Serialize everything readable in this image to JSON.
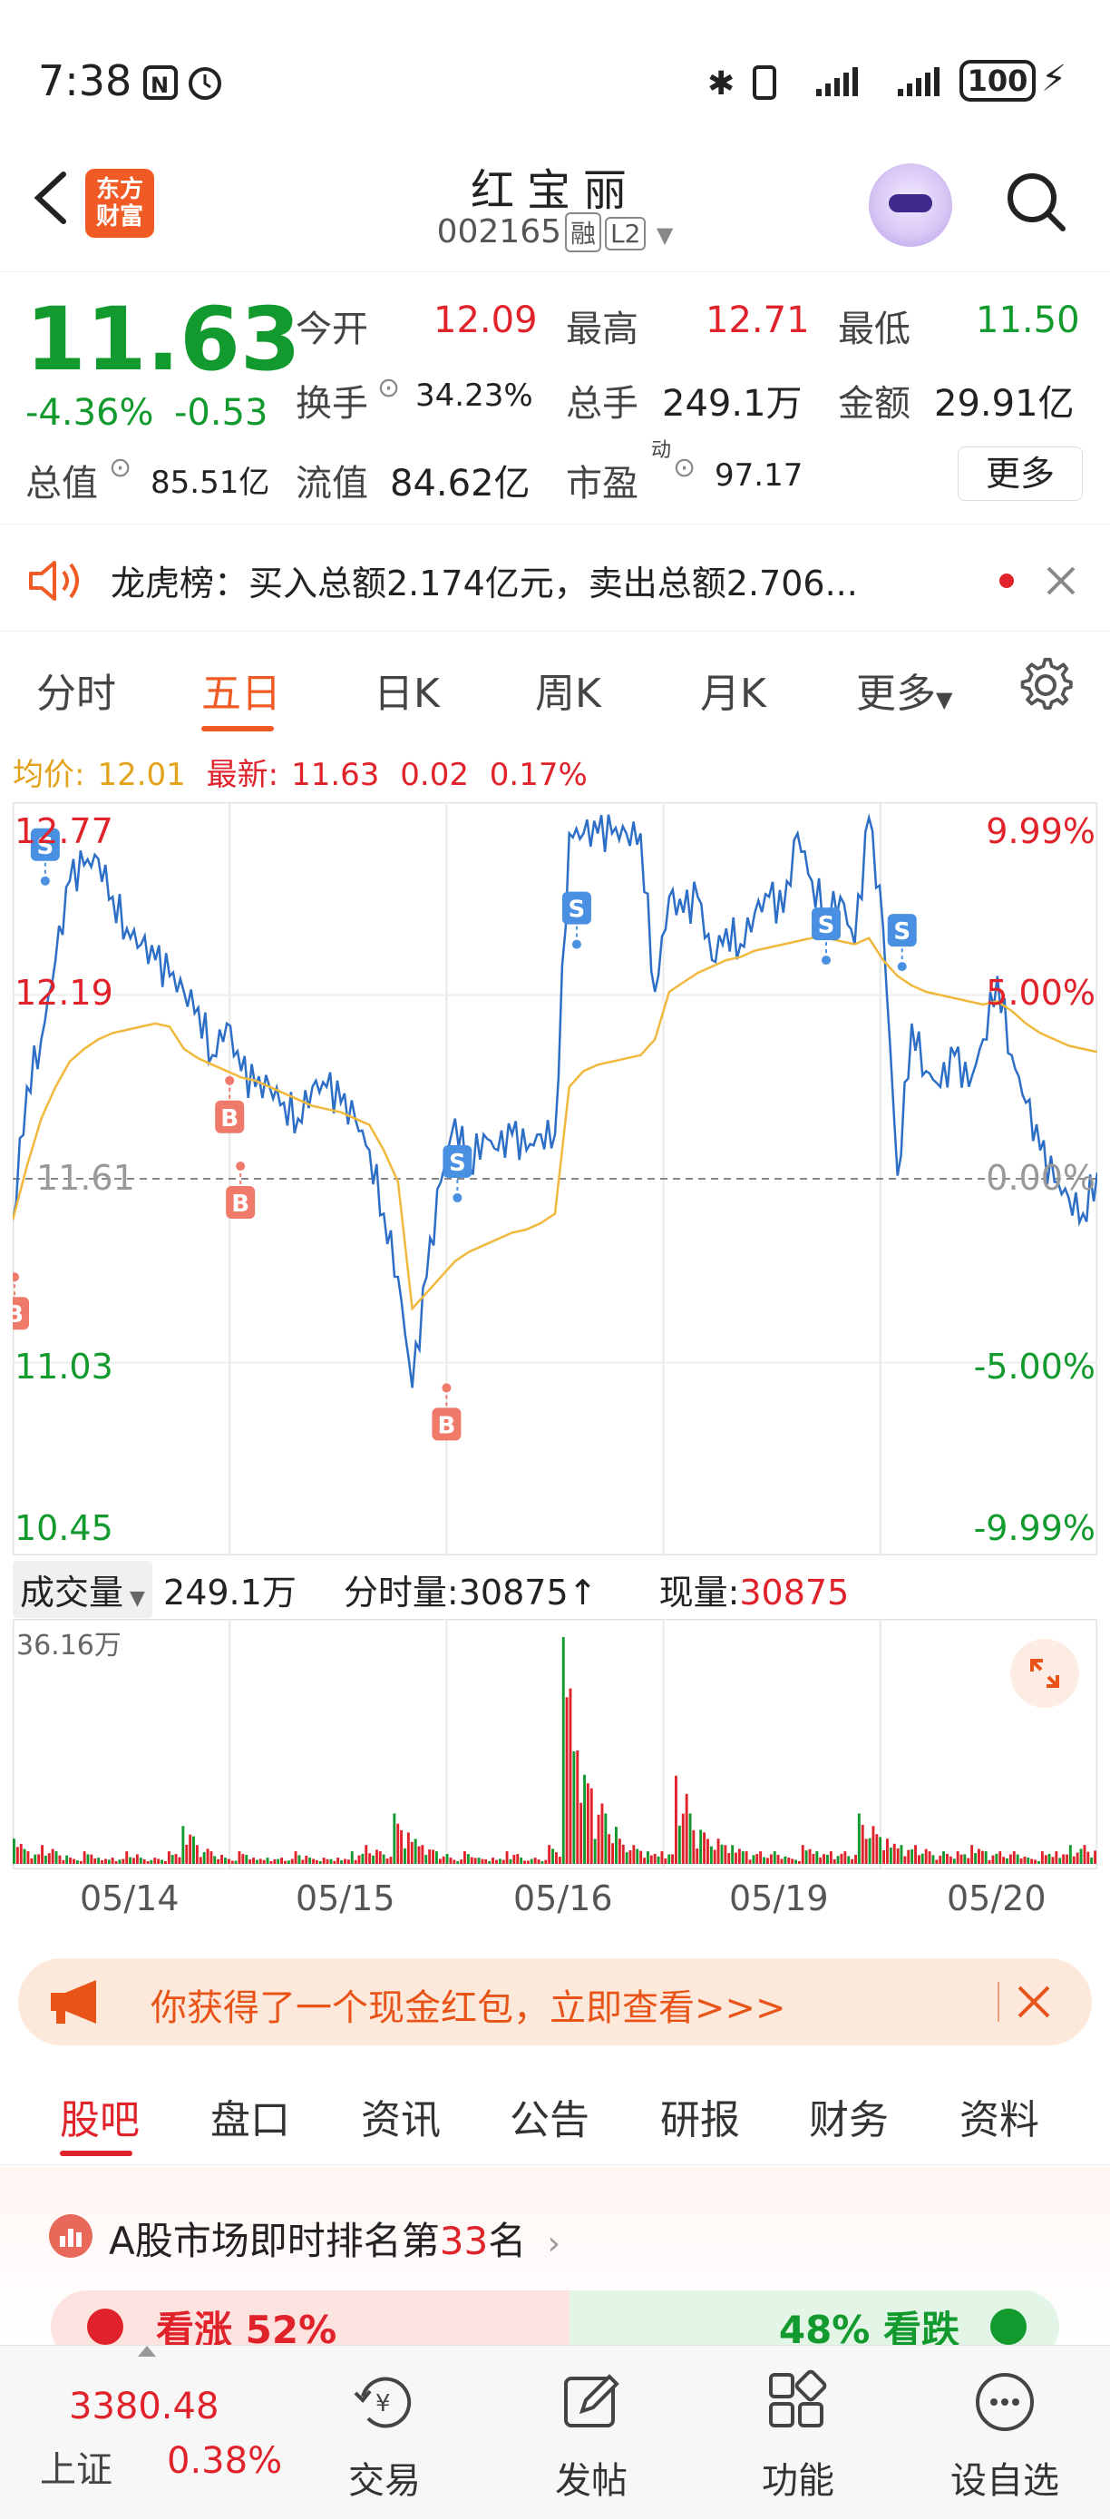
{
  "status_bar": {
    "time": "7:38",
    "battery": "100"
  },
  "header": {
    "title": "红宝丽",
    "code": "002165",
    "tags": [
      "融",
      "L2"
    ],
    "logo_text_1": "东方",
    "logo_text_2": "财富"
  },
  "quote": {
    "price": "11.63",
    "change_pct": "-4.36%",
    "change": "-0.53",
    "open_label": "今开",
    "open": "12.09",
    "high_label": "最高",
    "high": "12.71",
    "low_label": "最低",
    "low": "11.50",
    "turnover_label": "换手",
    "turnover": "34.23%",
    "volume_label": "总手",
    "volume": "249.1万",
    "amount_label": "金额",
    "amount": "29.91亿",
    "total_mv_label": "总值",
    "total_mv": "85.51亿",
    "float_mv_label": "流值",
    "float_mv": "84.62亿",
    "pe_label": "市盈",
    "pe_sup": "动",
    "pe": "97.17",
    "more_button": "更多"
  },
  "notice": {
    "text": "龙虎榜：买入总额2.174亿元，卖出总额2.706..."
  },
  "chart_tabs": [
    "分时",
    "五日",
    "日K",
    "周K",
    "月K",
    "更多"
  ],
  "chart_tabs_active": 1,
  "avg_line": {
    "avg_label": "均价:",
    "avg": "12.01",
    "latest_label": "最新:",
    "latest": "11.63",
    "chg": "0.02",
    "pct": "0.17%"
  },
  "chart_data": {
    "type": "line",
    "days": [
      "05/14",
      "05/15",
      "05/16",
      "05/19",
      "05/20"
    ],
    "ylim": [
      10.45,
      12.77
    ],
    "left_ticks": [
      "12.77",
      "12.19",
      "11.61",
      "11.03",
      "10.45"
    ],
    "right_ticks": [
      "9.99%",
      "5.00%",
      "0.00%",
      "-5.00%",
      "-9.99%"
    ],
    "prev_close": 11.61,
    "price_series": [
      11.48,
      11.9,
      12.05,
      12.3,
      12.55,
      12.6,
      12.62,
      12.5,
      12.4,
      12.35,
      12.3,
      12.25,
      12.2,
      12.15,
      12.0,
      12.1,
      11.95,
      11.9,
      11.9,
      11.85,
      11.8,
      11.9,
      11.9,
      11.85,
      11.8,
      11.7,
      11.5,
      11.3,
      10.95,
      11.3,
      11.6,
      11.8,
      11.65,
      11.75,
      11.7,
      11.75,
      11.7,
      11.75,
      11.75,
      12.7,
      12.7,
      12.7,
      12.7,
      12.7,
      12.7,
      12.2,
      12.5,
      12.45,
      12.5,
      12.3,
      12.4,
      12.35,
      12.45,
      12.5,
      12.45,
      12.7,
      12.55,
      12.45,
      12.5,
      12.35,
      12.75,
      12.4,
      11.62,
      12.1,
      11.95,
      11.9,
      12.0,
      11.9,
      12.05,
      12.25,
      12.0,
      11.85,
      11.7,
      11.6,
      11.55,
      11.5,
      11.63
    ],
    "avg_series": [
      11.48,
      11.65,
      11.8,
      11.9,
      11.98,
      12.02,
      12.05,
      12.07,
      12.08,
      12.09,
      12.1,
      12.09,
      12.02,
      11.99,
      11.97,
      11.95,
      11.93,
      11.92,
      11.9,
      11.88,
      11.86,
      11.84,
      11.83,
      11.82,
      11.8,
      11.78,
      11.7,
      11.6,
      11.2,
      11.25,
      11.3,
      11.35,
      11.38,
      11.4,
      11.42,
      11.44,
      11.45,
      11.47,
      11.5,
      11.9,
      11.95,
      11.97,
      11.98,
      11.99,
      12.0,
      12.05,
      12.2,
      12.23,
      12.26,
      12.28,
      12.3,
      12.31,
      12.33,
      12.34,
      12.35,
      12.36,
      12.37,
      12.37,
      12.36,
      12.35,
      12.37,
      12.3,
      12.25,
      12.22,
      12.2,
      12.19,
      12.18,
      12.17,
      12.16,
      12.17,
      12.14,
      12.1,
      12.07,
      12.05,
      12.03,
      12.02,
      12.01
    ],
    "markers": [
      {
        "type": "S",
        "price": 12.55
      },
      {
        "type": "B",
        "price": 11.92
      },
      {
        "type": "B",
        "price": 11.65
      },
      {
        "type": "S",
        "price": 11.55
      },
      {
        "type": "B",
        "price": 10.95
      },
      {
        "type": "S",
        "price": 12.35
      },
      {
        "type": "S",
        "price": 12.3
      },
      {
        "type": "S",
        "price": 12.28
      },
      {
        "type": "B",
        "price": 11.3
      }
    ],
    "volume_max_label": "36.16万",
    "volume_series": [
      4,
      2,
      3,
      2,
      1,
      2,
      1,
      1,
      2,
      1,
      1,
      2,
      6,
      3,
      2,
      1,
      2,
      1,
      1,
      1,
      2,
      1,
      1,
      1,
      2,
      3,
      2,
      8,
      5,
      3,
      2,
      1,
      2,
      1,
      1,
      2,
      1,
      1,
      3,
      36,
      18,
      12,
      8,
      4,
      3,
      2,
      2,
      14,
      8,
      5,
      4,
      3,
      2,
      2,
      2,
      1,
      3,
      2,
      2,
      2,
      8,
      6,
      4,
      3,
      3,
      2,
      2,
      2,
      3,
      2,
      2,
      2,
      1,
      2,
      2,
      3,
      3
    ]
  },
  "volume": {
    "label": "成交量",
    "total": "249.1万",
    "split_label": "分时量:",
    "split_value": "30875↑",
    "now_label": "现量:",
    "now_value": "30875"
  },
  "red_packet": {
    "text": "你获得了一个现金红包，立即查看>>>"
  },
  "info_tabs": [
    "股吧",
    "盘口",
    "资讯",
    "公告",
    "研报",
    "财务",
    "资料"
  ],
  "info_tabs_active": 0,
  "rank": {
    "text_prefix": "A股市场即时排名第",
    "rank": "33",
    "text_suffix": "名",
    "up_text": "看涨 52%",
    "down_text": "48% 看跌"
  },
  "bottom_nav": {
    "index_value": "3380.48",
    "index_name": "上证",
    "index_pct": "0.38%",
    "trade": "交易",
    "post": "发帖",
    "func": "功能",
    "watch": "设自选"
  }
}
